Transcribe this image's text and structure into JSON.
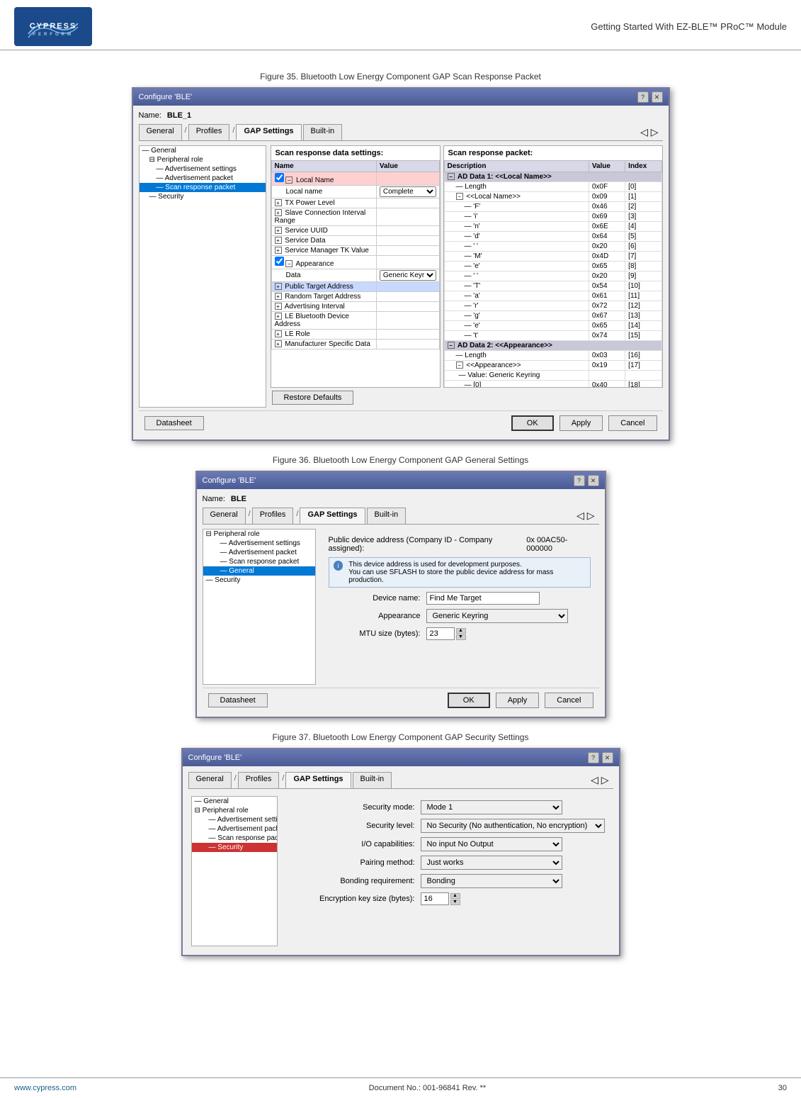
{
  "header": {
    "company": "CYPRESS",
    "tagline": "PERFORM",
    "title": "Getting Started With EZ-BLE™ PRoC™ Module"
  },
  "footer": {
    "website": "www.cypress.com",
    "docno": "Document No.: 001-96841 Rev. **",
    "page": "30"
  },
  "figure35": {
    "caption": "Figure 35. Bluetooth Low Energy Component GAP Scan Response Packet",
    "dialog": {
      "title": "Configure 'BLE'",
      "name_label": "Name:",
      "name_value": "BLE_1",
      "tabs": [
        "General",
        "Profiles",
        "GAP Settings",
        "Built-in"
      ],
      "active_tab": "GAP Settings",
      "left_tree": [
        {
          "label": "General",
          "indent": 0
        },
        {
          "label": "Peripheral role",
          "indent": 1,
          "expanded": true
        },
        {
          "label": "Advertisement settings",
          "indent": 2
        },
        {
          "label": "Advertisement packet",
          "indent": 2
        },
        {
          "label": "Scan response packet",
          "indent": 2,
          "selected": true
        },
        {
          "label": "Security",
          "indent": 1
        }
      ],
      "settings_title": "Scan response data settings:",
      "table_headers": [
        "Name",
        "Value"
      ],
      "table_rows": [
        {
          "name": "Local Name",
          "value": "",
          "checked": true,
          "expanded": true
        },
        {
          "name": "Local name",
          "value": "Complete",
          "indent": 1,
          "is_dropdown": true
        },
        {
          "name": "TX Power Level",
          "value": "",
          "checked": false
        },
        {
          "name": "Slave Connection Interval Range",
          "value": "",
          "checked": false
        },
        {
          "name": "Service UUID",
          "value": "",
          "checked": false
        },
        {
          "name": "Service Data",
          "value": "",
          "checked": false
        },
        {
          "name": "Service Manager TK Value",
          "value": "",
          "checked": false
        },
        {
          "name": "Appearance",
          "value": "",
          "checked": true,
          "expanded": true
        },
        {
          "name": "Data",
          "value": "Generic Keyring",
          "indent": 1,
          "is_dropdown": true
        },
        {
          "name": "Public Target Address",
          "value": "",
          "selected": true
        },
        {
          "name": "Random Target Address",
          "value": "",
          "checked": false
        },
        {
          "name": "Advertising Interval",
          "value": "",
          "checked": false
        },
        {
          "name": "LE Bluetooth Device Address",
          "value": "",
          "checked": false
        },
        {
          "name": "LE Role",
          "value": "",
          "checked": false
        },
        {
          "name": "Manufacturer Specific Data",
          "value": "",
          "checked": false
        }
      ],
      "response_title": "Scan response packet:",
      "response_headers": [
        "Description",
        "Value",
        "Index"
      ],
      "response_rows": [
        {
          "desc": "AD Data 1: <<Local Name>>",
          "value": "",
          "index": "",
          "level": "group"
        },
        {
          "desc": "Length",
          "value": "0x0F",
          "index": "[0]",
          "level": "sub"
        },
        {
          "desc": "<<Local Name>>",
          "value": "0x09",
          "index": "[1]",
          "level": "sub"
        },
        {
          "desc": "'F'",
          "value": "0x46",
          "index": "[2]",
          "level": "sub2"
        },
        {
          "desc": "'i'",
          "value": "0x69",
          "index": "[3]",
          "level": "sub2"
        },
        {
          "desc": "'n'",
          "value": "0x6E",
          "index": "[4]",
          "level": "sub2"
        },
        {
          "desc": "'d'",
          "value": "0x64",
          "index": "[5]",
          "level": "sub2"
        },
        {
          "desc": "' '",
          "value": "0x20",
          "index": "[6]",
          "level": "sub2"
        },
        {
          "desc": "'M'",
          "value": "0x4D",
          "index": "[7]",
          "level": "sub2"
        },
        {
          "desc": "'e'",
          "value": "0x65",
          "index": "[8]",
          "level": "sub2"
        },
        {
          "desc": "' '",
          "value": "0x20",
          "index": "[9]",
          "level": "sub2"
        },
        {
          "desc": "'T'",
          "value": "0x54",
          "index": "[10]",
          "level": "sub2"
        },
        {
          "desc": "'a'",
          "value": "0x61",
          "index": "[11]",
          "level": "sub2"
        },
        {
          "desc": "'r'",
          "value": "0x72",
          "index": "[12]",
          "level": "sub2"
        },
        {
          "desc": "'g'",
          "value": "0x67",
          "index": "[13]",
          "level": "sub2"
        },
        {
          "desc": "'e'",
          "value": "0x65",
          "index": "[14]",
          "level": "sub2"
        },
        {
          "desc": "'t'",
          "value": "0x74",
          "index": "[15]",
          "level": "sub2"
        },
        {
          "desc": "AD Data 2: <<Appearance>>",
          "value": "",
          "index": "",
          "level": "group"
        },
        {
          "desc": "Length",
          "value": "0x03",
          "index": "[16]",
          "level": "sub"
        },
        {
          "desc": "<<Appearance>>",
          "value": "0x19",
          "index": "[17]",
          "level": "sub"
        },
        {
          "desc": "Value: Generic Keyring",
          "value": "",
          "index": "",
          "level": "sub"
        },
        {
          "desc": "[0]",
          "value": "0x40",
          "index": "[18]",
          "level": "sub2"
        }
      ],
      "buttons": {
        "restore": "Restore Defaults",
        "datasheet": "Datasheet",
        "ok": "OK",
        "apply": "Apply",
        "cancel": "Cancel"
      }
    }
  },
  "figure36": {
    "caption": "Figure 36. Bluetooth Low Energy Component GAP General Settings",
    "dialog": {
      "title": "Configure 'BLE'",
      "name_label": "Name:",
      "name_value": "BLE",
      "tabs": [
        "General",
        "Profiles",
        "GAP Settings",
        "Built-in"
      ],
      "active_tab": "GAP Settings",
      "left_tree": [
        {
          "label": "Peripheral role",
          "indent": 0,
          "expanded": true
        },
        {
          "label": "Advertisement settings",
          "indent": 1
        },
        {
          "label": "Advertisement packet",
          "indent": 1
        },
        {
          "label": "Scan response packet",
          "indent": 1
        },
        {
          "label": "General",
          "indent": 1,
          "selected": true
        },
        {
          "label": "Security",
          "indent": 0
        }
      ],
      "public_addr_label": "Public device address (Company ID - Company assigned):",
      "public_addr_value": "0x  00AC50-000000",
      "info_text1": "This device address is used for development purposes.",
      "info_text2": "You can use SFLASH to store the public device address for mass production.",
      "device_name_label": "Device name:",
      "device_name_value": "Find Me Target",
      "appearance_label": "Appearance",
      "appearance_value": "Generic Keyring",
      "mtu_label": "MTU size (bytes):",
      "mtu_value": "23",
      "buttons": {
        "datasheet": "Datasheet",
        "ok": "OK",
        "apply": "Apply",
        "cancel": "Cancel"
      }
    }
  },
  "figure37": {
    "caption": "Figure 37. Bluetooth Low Energy Component GAP Security Settings",
    "dialog": {
      "title": "Configure 'BLE'",
      "tabs": [
        "General",
        "Profiles",
        "GAP Settings",
        "Built-in"
      ],
      "active_tab": "GAP Settings",
      "left_tree": [
        {
          "label": "General",
          "indent": 0
        },
        {
          "label": "Peripheral role",
          "indent": 0,
          "expanded": true
        },
        {
          "label": "Advertisement settings",
          "indent": 1
        },
        {
          "label": "Advertisement packet",
          "indent": 1
        },
        {
          "label": "Scan response packet",
          "indent": 1
        },
        {
          "label": "Security",
          "indent": 1,
          "selected": true,
          "selected_red": true
        }
      ],
      "fields": [
        {
          "label": "Security mode:",
          "value": "Mode 1",
          "type": "select"
        },
        {
          "label": "Security level:",
          "value": "No Security (No authentication, No encryption)",
          "type": "select"
        },
        {
          "label": "I/O capabilities:",
          "value": "No input No Output",
          "type": "select"
        },
        {
          "label": "Pairing method:",
          "value": "Just works",
          "type": "select"
        },
        {
          "label": "Bonding requirement:",
          "value": "Bonding",
          "type": "select"
        },
        {
          "label": "Encryption key size (bytes):",
          "value": "16",
          "type": "spinner"
        }
      ]
    }
  }
}
